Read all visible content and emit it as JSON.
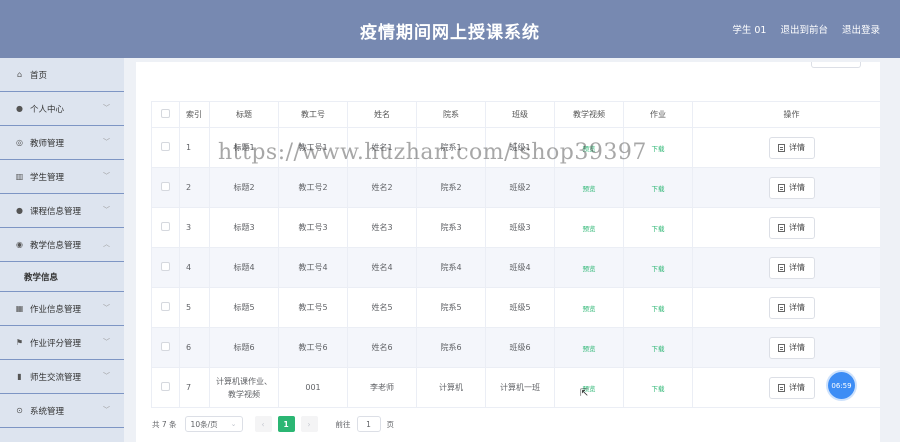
{
  "header": {
    "title": "疫情期间网上授课系统",
    "links": [
      "学生 01",
      "退出到前台",
      "退出登录"
    ]
  },
  "sidebar": {
    "items": [
      {
        "label": "首页",
        "icon": "home-icon",
        "glyph": "⌂",
        "chevron": false
      },
      {
        "label": "个人中心",
        "icon": "user-icon",
        "glyph": "●",
        "chevron": true
      },
      {
        "label": "教师管理",
        "icon": "circle-icon",
        "glyph": "◎",
        "chevron": true
      },
      {
        "label": "学生管理",
        "icon": "bank-icon",
        "glyph": "▥",
        "chevron": true
      },
      {
        "label": "课程信息管理",
        "icon": "user-icon",
        "glyph": "●",
        "chevron": true
      },
      {
        "label": "教学信息管理",
        "icon": "location-icon",
        "glyph": "◉",
        "chevron": true,
        "open": true
      },
      {
        "label": "作业信息管理",
        "icon": "ticket-icon",
        "glyph": "▦",
        "chevron": true
      },
      {
        "label": "作业评分管理",
        "icon": "flag-icon",
        "glyph": "⚑",
        "chevron": true
      },
      {
        "label": "师生交流管理",
        "icon": "chart-icon",
        "glyph": "▮",
        "chevron": true
      },
      {
        "label": "系统管理",
        "icon": "gear-icon",
        "glyph": "⊙",
        "chevron": true
      }
    ],
    "sub_item": "教学信息"
  },
  "table": {
    "headers": [
      "索引",
      "标题",
      "教工号",
      "姓名",
      "院系",
      "班级",
      "教学视频",
      "作业",
      "操作"
    ],
    "rows": [
      {
        "idx": "1",
        "title": "标题1",
        "no": "教工号1",
        "name": "姓名1",
        "dept": "院系1",
        "cls": "班级1",
        "video": "预览",
        "hw": "下载",
        "op": "详情"
      },
      {
        "idx": "2",
        "title": "标题2",
        "no": "教工号2",
        "name": "姓名2",
        "dept": "院系2",
        "cls": "班级2",
        "video": "预览",
        "hw": "下载",
        "op": "详情"
      },
      {
        "idx": "3",
        "title": "标题3",
        "no": "教工号3",
        "name": "姓名3",
        "dept": "院系3",
        "cls": "班级3",
        "video": "预览",
        "hw": "下载",
        "op": "详情"
      },
      {
        "idx": "4",
        "title": "标题4",
        "no": "教工号4",
        "name": "姓名4",
        "dept": "院系4",
        "cls": "班级4",
        "video": "预览",
        "hw": "下载",
        "op": "详情"
      },
      {
        "idx": "5",
        "title": "标题5",
        "no": "教工号5",
        "name": "姓名5",
        "dept": "院系5",
        "cls": "班级5",
        "video": "预览",
        "hw": "下载",
        "op": "详情"
      },
      {
        "idx": "6",
        "title": "标题6",
        "no": "教工号6",
        "name": "姓名6",
        "dept": "院系6",
        "cls": "班级6",
        "video": "预览",
        "hw": "下载",
        "op": "详情"
      },
      {
        "idx": "7",
        "title": "计算机课作业、教学视频",
        "no": "001",
        "name": "李老师",
        "dept": "计算机",
        "cls": "计算机一班",
        "video": "预览",
        "hw": "下载",
        "op": "详情"
      }
    ]
  },
  "pagination": {
    "total": "共 7 条",
    "page_size": "10条/页",
    "prev": "‹",
    "current": "1",
    "next": "›",
    "goto_label": "前往",
    "goto_value": "1",
    "page_suffix": "页"
  },
  "timer": "06:59",
  "watermark": "https://www.huzhan.com/ishop39397",
  "colors": {
    "header": "#7789b1",
    "sidebar": "#dde4ef",
    "accent": "#2bb673",
    "timer": "#3d8df5"
  }
}
